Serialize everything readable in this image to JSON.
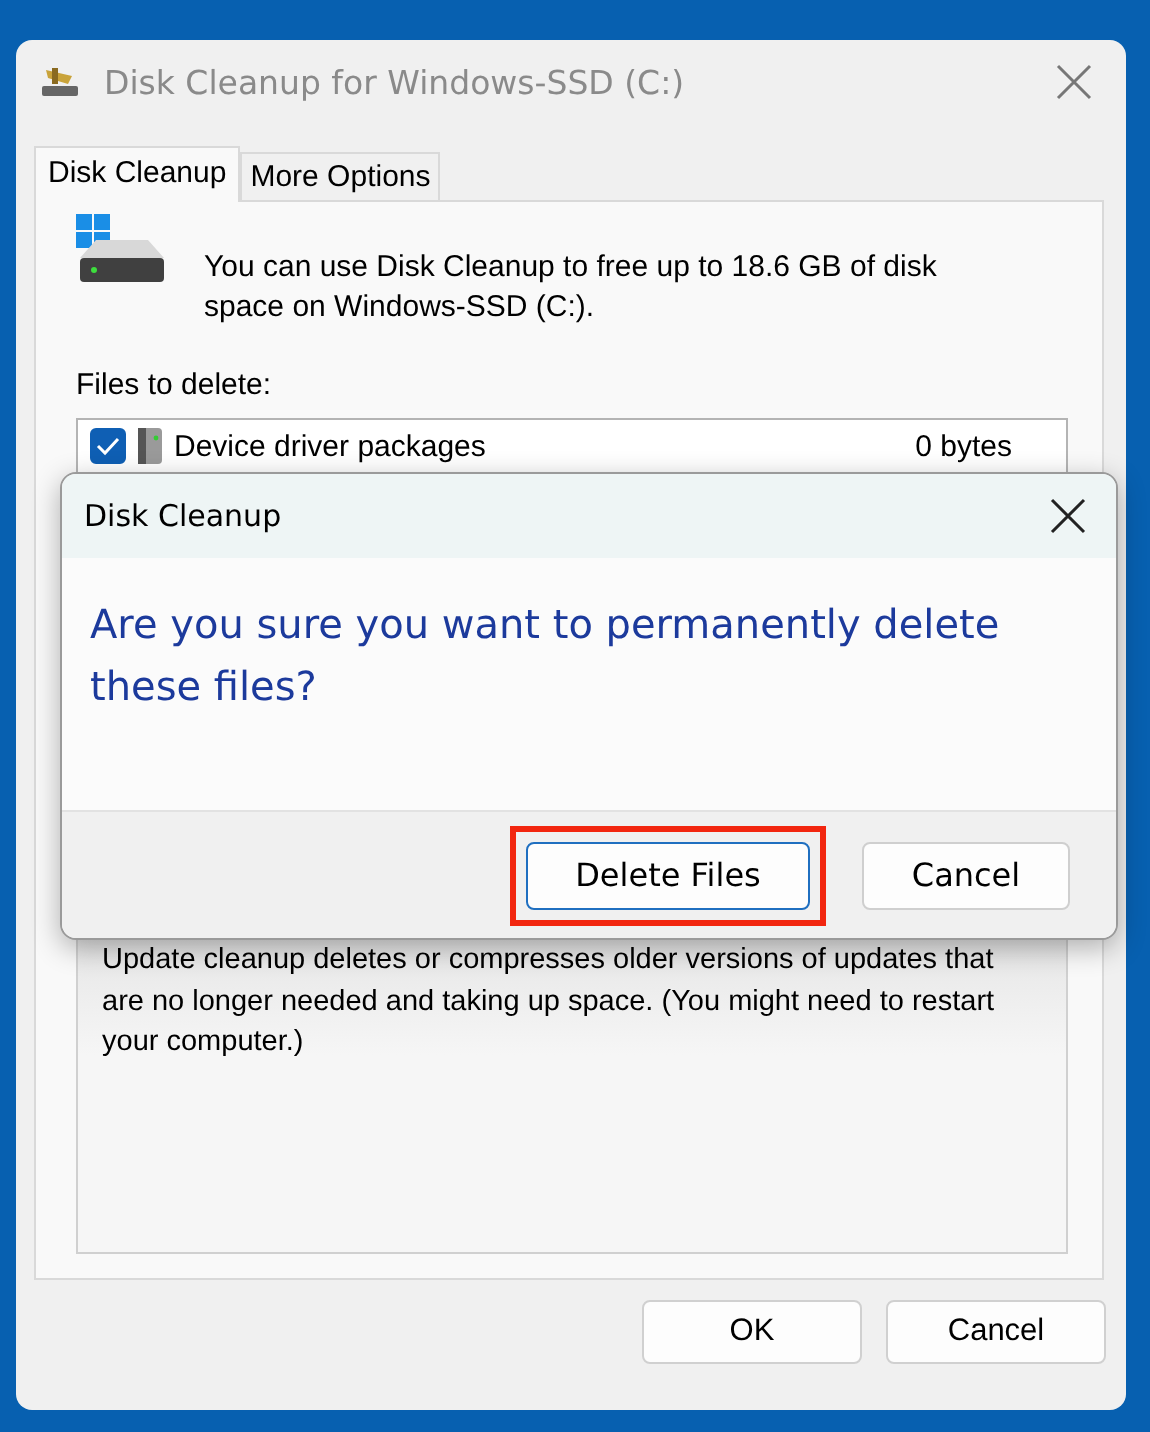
{
  "window": {
    "title": "Disk Cleanup for Windows-SSD (C:)"
  },
  "tabs": [
    {
      "label": "Disk Cleanup",
      "selected": true
    },
    {
      "label": "More Options",
      "selected": false
    }
  ],
  "intro": "You can use Disk Cleanup to free up to 18.6 GB of disk space on Windows-SSD (C:).",
  "files_label": "Files to delete:",
  "files": [
    {
      "name": "Device driver packages",
      "size": "0 bytes",
      "checked": true
    }
  ],
  "description": "Update cleanup deletes or compresses older versions of updates that are no longer needed and taking up space. (You might need to restart your computer.)",
  "buttons": [
    "OK",
    "Cancel"
  ],
  "dialog": {
    "title": "Disk Cleanup",
    "message": "Are you sure you want to permanently delete these files?",
    "buttons": [
      {
        "label": "Delete Files",
        "default": true,
        "highlighted": true
      },
      {
        "label": "Cancel",
        "default": false,
        "highlighted": false
      }
    ]
  }
}
